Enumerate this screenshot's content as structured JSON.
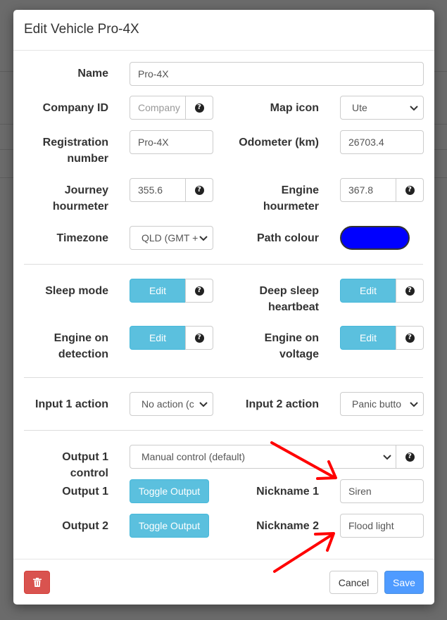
{
  "modal": {
    "title": "Edit Vehicle Pro-4X"
  },
  "fields": {
    "name": {
      "label": "Name",
      "value": "Pro-4X"
    },
    "company_id": {
      "label": "Company ID",
      "placeholder": "Company"
    },
    "map_icon": {
      "label": "Map icon",
      "value": "Ute"
    },
    "registration": {
      "label_line1": "Registration",
      "label_line2": "number",
      "value": "Pro-4X"
    },
    "odometer": {
      "label": "Odometer (km)",
      "value": "26703.4"
    },
    "journey_hourmeter": {
      "label_line1": "Journey",
      "label_line2": "hourmeter",
      "value": "355.6"
    },
    "engine_hourmeter": {
      "label_line1": "Engine",
      "label_line2": "hourmeter",
      "value": "367.8"
    },
    "timezone": {
      "label": "Timezone",
      "value": "QLD (GMT +"
    },
    "path_colour": {
      "label": "Path colour",
      "color": "#0000ff"
    },
    "sleep_mode": {
      "label": "Sleep mode",
      "button": "Edit"
    },
    "deep_sleep": {
      "label_line1": "Deep sleep",
      "label_line2": "heartbeat",
      "button": "Edit"
    },
    "engine_detection": {
      "label_line1": "Engine on",
      "label_line2": "detection",
      "button": "Edit"
    },
    "engine_voltage": {
      "label_line1": "Engine on",
      "label_line2": "voltage",
      "button": "Edit"
    },
    "input1": {
      "label": "Input 1 action",
      "value": "No action (c"
    },
    "input2": {
      "label": "Input 2 action",
      "value": "Panic butto"
    },
    "output1_control": {
      "label": "Output 1 control",
      "value": "Manual control (default)"
    },
    "output1": {
      "label": "Output 1",
      "button": "Toggle Output"
    },
    "output2": {
      "label": "Output 2",
      "button": "Toggle Output"
    },
    "nickname1": {
      "label": "Nickname 1",
      "value": "Siren"
    },
    "nickname2": {
      "label": "Nickname 2",
      "value": "Flood light"
    }
  },
  "footer": {
    "cancel": "Cancel",
    "save": "Save"
  },
  "icons": {
    "help": "question-circle-icon",
    "delete": "trash-icon",
    "dropdown": "chevron-down-icon",
    "annotation": "red-arrow-icon"
  },
  "colors": {
    "info": "#5bc0de",
    "danger": "#d9534f",
    "primary": "#4f9bff",
    "arrow": "#ff0000"
  }
}
